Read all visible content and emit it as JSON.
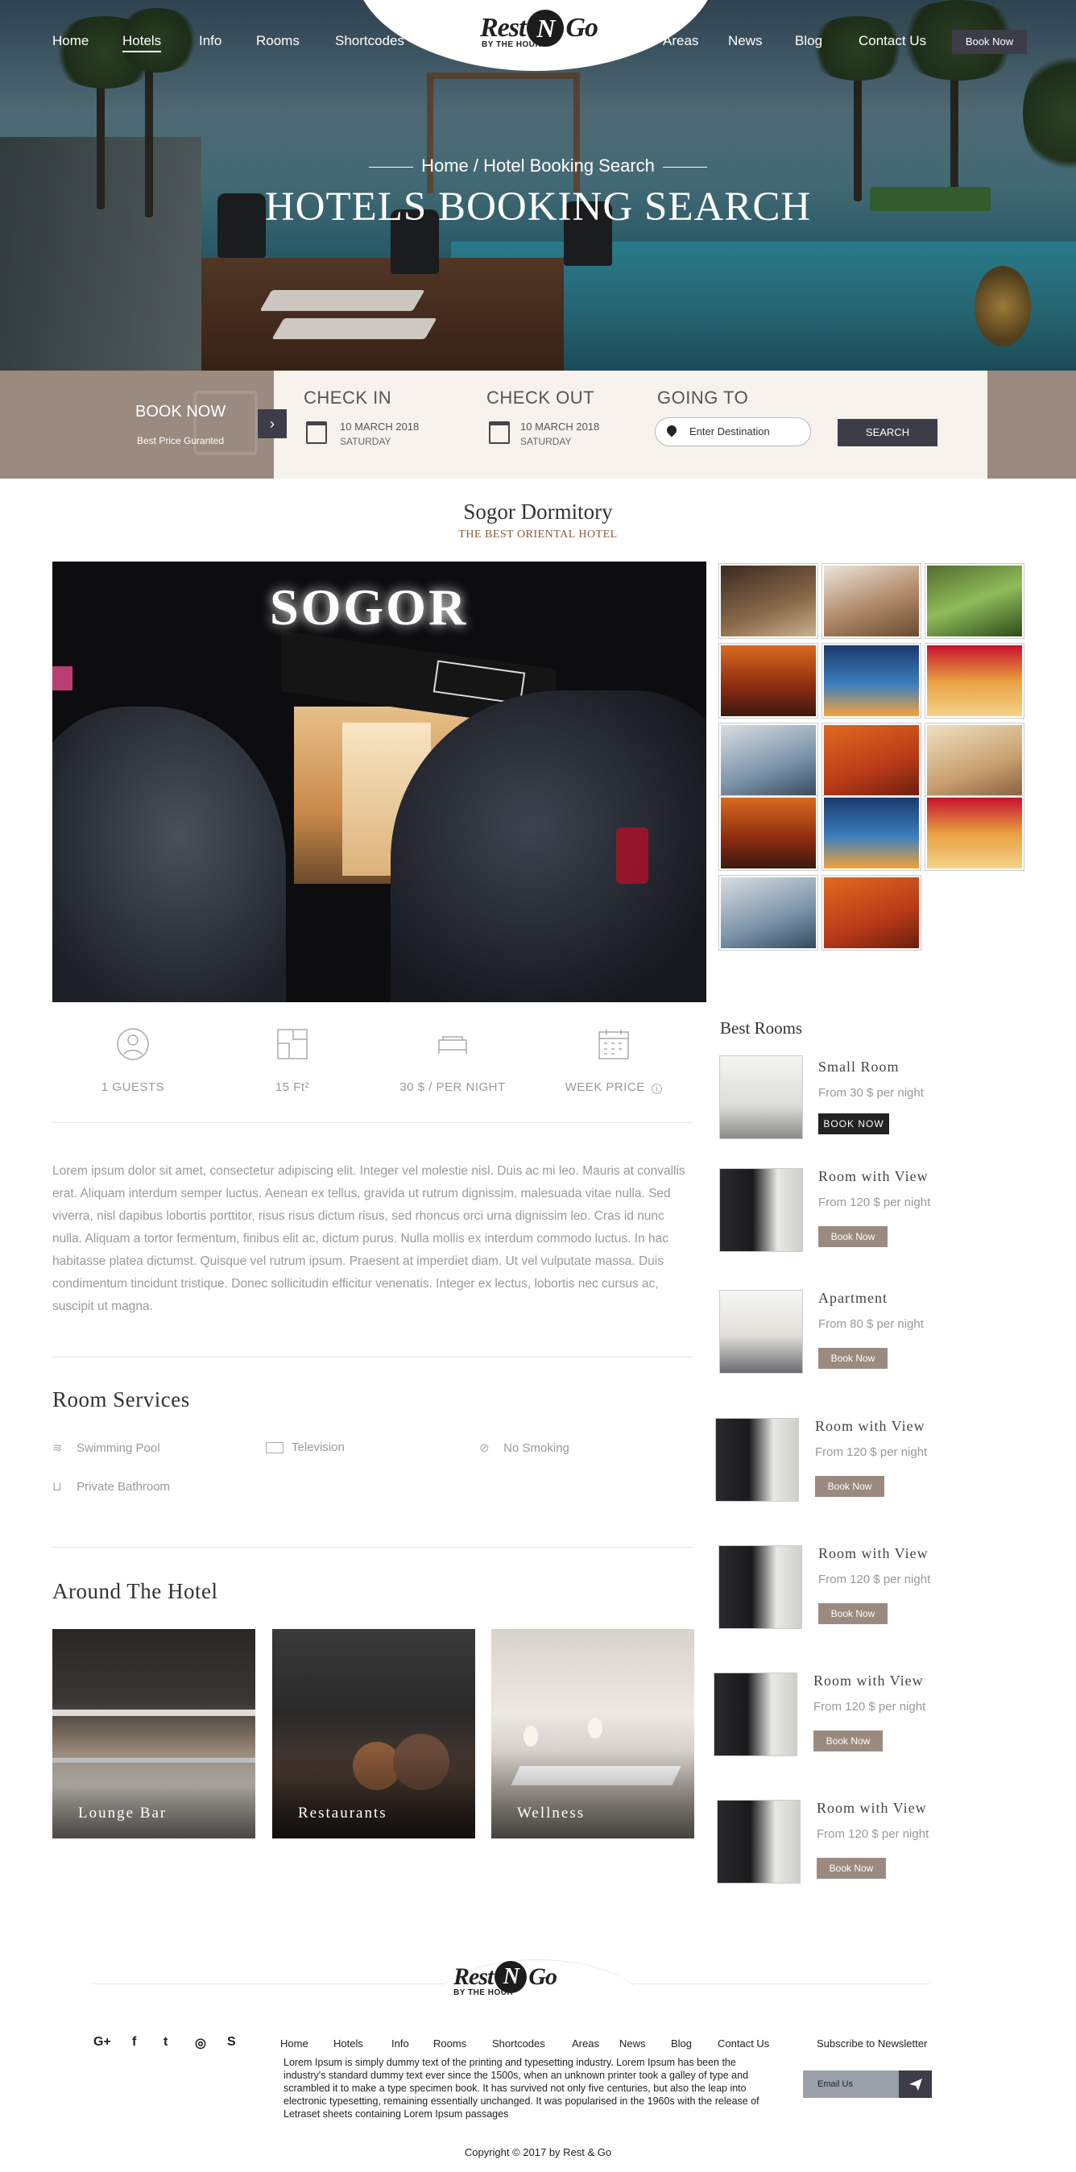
{
  "nav": {
    "items": [
      "Home",
      "Hotels",
      "Info",
      "Rooms",
      "Shortcodes",
      "Areas",
      "News",
      "Blog",
      "Contact Us"
    ],
    "active": "Hotels",
    "cta": "Book Now"
  },
  "logo": {
    "left": "Rest",
    "mid": "N",
    "right": "Go",
    "tagline": "BY THE HOUR"
  },
  "hero": {
    "breadcrumb": "Home / Hotel Booking Search",
    "title": "HOTELS BOOKING SEARCH"
  },
  "booking": {
    "book_now": "BOOK NOW",
    "best_price": "Best Price Guranted",
    "checkin": {
      "label": "CHECK IN",
      "date": "10 MARCH 2018",
      "day": "SATURDAY"
    },
    "checkout": {
      "label": "CHECK OUT",
      "date": "10 MARCH 2018",
      "day": "SATURDAY"
    },
    "going": {
      "label": "GOING TO",
      "placeholder": "Enter Destination"
    },
    "search": "SEARCH"
  },
  "hotel": {
    "name": "Sogor Dormitory",
    "tagline": "THE BEST ORIENTAL HOTEL",
    "sign": "SOGOR"
  },
  "amenities": {
    "guests": "1 GUESTS",
    "area": "15 Ft²",
    "price": "30 $ / PER NIGHT",
    "week": "WEEK PRICE"
  },
  "description": "Lorem ipsum dolor sit amet, consectetur adipiscing elit. Integer vel molestie nisl. Duis ac mi leo. Mauris at convallis erat. Aliquam interdum semper luctus. Aenean ex tellus, gravida ut rutrum dignissim, malesuada vitae nulla. Sed viverra, nisl dapibus lobortis porttitor, risus risus dictum risus, sed rhoncus orci urna dignissim leo. Cras id nunc nulla. Aliquam a tortor fermentum, finibus elit ac, dictum purus. Nulla mollis ex interdum commodo luctus. In hac habitasse platea dictumst. Quisque vel rutrum ipsum. Praesent at imperdiet diam. Ut vel vulputate massa. Duis condimentum tincidunt tristique. Donec sollicitudin efficitur venenatis. Integer ex lectus, lobortis nec cursus ac, suscipit ut magna.",
  "services": {
    "title": "Room Services",
    "items": [
      "Swimming Pool",
      "Television",
      "No Smoking",
      "Private Bathroom"
    ]
  },
  "around": {
    "title": "Around The Hotel",
    "items": [
      "Lounge Bar",
      "Restaurants",
      "Wellness"
    ]
  },
  "best_rooms": {
    "title": "Best Rooms",
    "items": [
      {
        "name": "Small Room",
        "price": "From 30 $ per night",
        "button": "BOOK NOW"
      },
      {
        "name": "Room with View",
        "price": "From 120 $ per night",
        "button": "Book Now"
      },
      {
        "name": "Apartment",
        "price": "From 80 $ per night",
        "button": "Book Now"
      },
      {
        "name": "Room with View",
        "price": "From 120 $ per night",
        "button": "Book Now"
      },
      {
        "name": "Room with View",
        "price": "From 120 $ per night",
        "button": "Book Now"
      },
      {
        "name": "Room with View",
        "price": "From 120 $ per night",
        "button": "Book Now"
      },
      {
        "name": "Room with View",
        "price": "From 120 $ per night",
        "button": "Book Now"
      }
    ]
  },
  "footer": {
    "nav": [
      "Home",
      "Hotels",
      "Info",
      "Rooms",
      "Shortcodes",
      "Areas",
      "News",
      "Blog",
      "Contact Us"
    ],
    "social_icons": [
      "google-plus-icon",
      "facebook-icon",
      "twitter-icon",
      "instagram-icon",
      "skype-icon"
    ],
    "social_glyphs": [
      "G+",
      "f",
      "t",
      "◎",
      "S"
    ],
    "text": "Lorem Ipsum is simply dummy text of the printing and typesetting industry. Lorem Ipsum has been the industry's standard dummy text ever since the 1500s, when an unknown printer took a galley of type and scrambled it to make a type specimen book. It has survived not only five centuries, but also the leap into electronic typesetting, remaining essentially unchanged. It was popularised in the 1960s with the release of Letraset sheets containing Lorem Ipsum passages",
    "newsletter": "Subscribe to Newsletter",
    "email_placeholder": "Email Us",
    "copyright": "Copyright © 2017 by Rest & Go"
  }
}
